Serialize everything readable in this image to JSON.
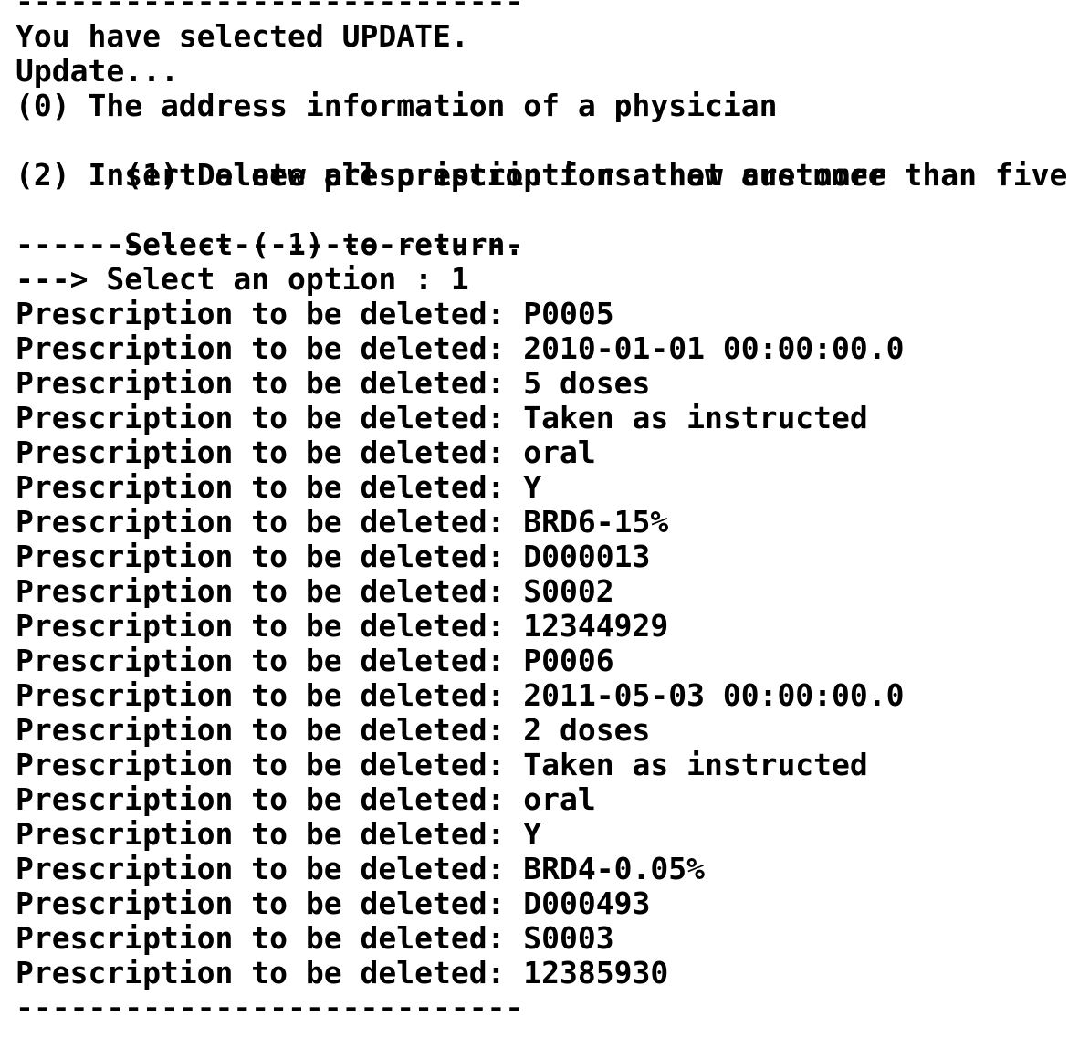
{
  "console": {
    "separator": "----------------------------",
    "header": {
      "selected": "You have selected UPDATE.",
      "prompt": "Update..."
    },
    "menu_options": [
      "(0) The address information of a physician",
      "(1) Delete all prescriptions that are more than five years",
      "(2) Insert a new prescription for a new customer"
    ],
    "return_hint": "Select (-1) to return.",
    "input_prompt": "---> Select an option : 1",
    "output_lines": [
      "Prescription to be deleted: P0005",
      "Prescription to be deleted: 2010-01-01 00:00:00.0",
      "Prescription to be deleted: 5 doses",
      "Prescription to be deleted: Taken as instructed",
      "Prescription to be deleted: oral",
      "Prescription to be deleted: Y",
      "Prescription to be deleted: BRD6-15%",
      "Prescription to be deleted: D000013",
      "Prescription to be deleted: S0002",
      "Prescription to be deleted: 12344929",
      "Prescription to be deleted: P0006",
      "Prescription to be deleted: 2011-05-03 00:00:00.0",
      "Prescription to be deleted: 2 doses",
      "Prescription to be deleted: Taken as instructed",
      "Prescription to be deleted: oral",
      "Prescription to be deleted: Y",
      "Prescription to be deleted: BRD4-0.05%",
      "Prescription to be deleted: D000493",
      "Prescription to be deleted: S0003",
      "Prescription to be deleted: 12385930"
    ]
  }
}
